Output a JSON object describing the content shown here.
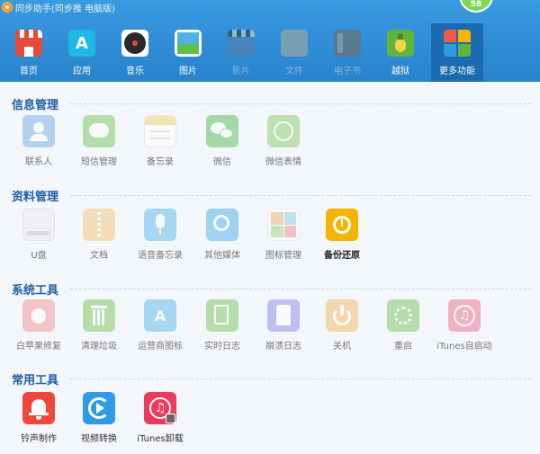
{
  "window": {
    "title": "同步助手(同步推 电脑版)",
    "badge_count": "58"
  },
  "toolbar": {
    "items": [
      {
        "label": "首页",
        "icon": "home-icon",
        "color": "#e84a3a",
        "state": "normal"
      },
      {
        "label": "应用",
        "icon": "app-store-icon",
        "color": "#1fb6e8",
        "state": "normal"
      },
      {
        "label": "音乐",
        "icon": "music-disc-icon",
        "color": "#2a2a2a",
        "state": "normal"
      },
      {
        "label": "图片",
        "icon": "photo-icon",
        "color": "#4db3e6",
        "state": "normal"
      },
      {
        "label": "影片",
        "icon": "film-clapper-icon",
        "color": "#5a7ea3",
        "state": "disabled"
      },
      {
        "label": "文件",
        "icon": "folder-icon",
        "color": "#9b8f7d",
        "state": "disabled"
      },
      {
        "label": "电子书",
        "icon": "book-icon",
        "color": "#7c6a55",
        "state": "disabled"
      },
      {
        "label": "越狱",
        "icon": "pineapple-icon",
        "color": "#62b33c",
        "state": "normal"
      },
      {
        "label": "更多功能",
        "icon": "tiles-icon",
        "color": "#f05a4a",
        "state": "active"
      }
    ]
  },
  "sections": [
    {
      "title": "信息管理",
      "tiles": [
        {
          "label": "联系人",
          "icon": "contacts-icon",
          "color": "#6aa8e0",
          "state": "dim"
        },
        {
          "label": "短信管理",
          "icon": "sms-icon",
          "color": "#6cc04a",
          "state": "dim"
        },
        {
          "label": "备忘录",
          "icon": "notes-icon",
          "color": "#f2cf5b",
          "state": "dim"
        },
        {
          "label": "微信",
          "icon": "wechat-icon",
          "color": "#45b845",
          "state": "dim"
        },
        {
          "label": "微信表情",
          "icon": "emoji-icon",
          "color": "#7fc95a",
          "state": "dim"
        }
      ]
    },
    {
      "title": "资料管理",
      "tiles": [
        {
          "label": "U盘",
          "icon": "usb-drive-icon",
          "color": "#cfd3d8",
          "state": "dim"
        },
        {
          "label": "文档",
          "icon": "document-icon",
          "color": "#f1c06a",
          "state": "dim"
        },
        {
          "label": "语音备忘录",
          "icon": "microphone-icon",
          "color": "#4ab3ea",
          "state": "dim"
        },
        {
          "label": "其他媒体",
          "icon": "media-search-icon",
          "color": "#3aa5e6",
          "state": "dim"
        },
        {
          "label": "图标管理",
          "icon": "icon-grid-icon",
          "color": "#e9a76a",
          "state": "dim"
        },
        {
          "label": "备份还原",
          "icon": "backup-restore-icon",
          "color": "#f5b400",
          "state": "strong"
        }
      ]
    },
    {
      "title": "系统工具",
      "tiles": [
        {
          "label": "白苹果修复",
          "icon": "apple-repair-icon",
          "color": "#ef8a8a",
          "state": "dim"
        },
        {
          "label": "清理垃圾",
          "icon": "trash-icon",
          "color": "#6cc04a",
          "state": "dim"
        },
        {
          "label": "运营商图标",
          "icon": "carrier-antenna-icon",
          "color": "#4ab3ea",
          "state": "dim"
        },
        {
          "label": "实时日志",
          "icon": "realtime-log-icon",
          "color": "#6cc04a",
          "state": "dim"
        },
        {
          "label": "崩溃日志",
          "icon": "crash-log-icon",
          "color": "#7b7ee6",
          "state": "dim"
        },
        {
          "label": "关机",
          "icon": "power-icon",
          "color": "#f0b24a",
          "state": "dim"
        },
        {
          "label": "重启",
          "icon": "restart-icon",
          "color": "#6cc04a",
          "state": "dim"
        },
        {
          "label": "iTunes自启动",
          "icon": "itunes-autostart-icon",
          "color": "#ef5f7a",
          "state": "dim"
        }
      ]
    },
    {
      "title": "常用工具",
      "tiles": [
        {
          "label": "铃声制作",
          "icon": "bell-icon",
          "color": "#f0463c",
          "state": "normal"
        },
        {
          "label": "视频转换",
          "icon": "video-convert-icon",
          "color": "#2f9ae6",
          "state": "normal"
        },
        {
          "label": "iTunes卸载",
          "icon": "itunes-uninstall-icon",
          "color": "#ef3b5a",
          "state": "normal"
        }
      ]
    }
  ]
}
